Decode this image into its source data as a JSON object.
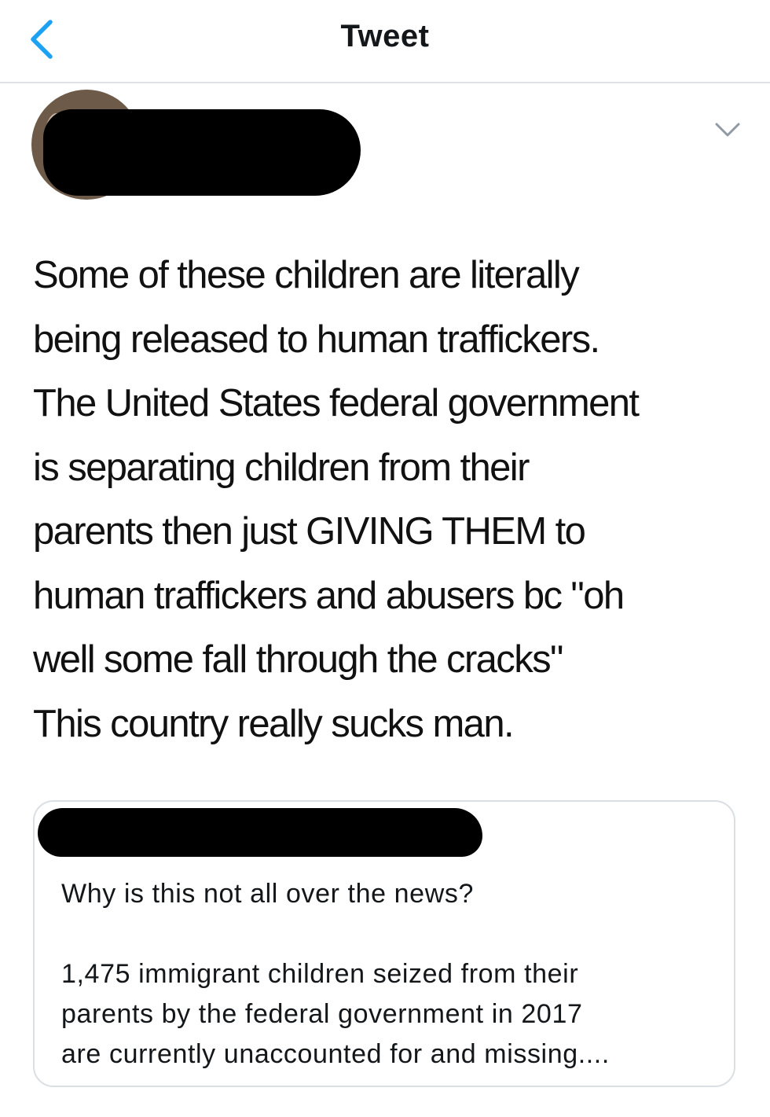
{
  "nav": {
    "title": "Tweet",
    "back_icon": "chevron-left-icon",
    "accent_color": "#1da1f2"
  },
  "tweet": {
    "author": {
      "avatar": "avatar",
      "name_redacted": true
    },
    "menu_icon": "chevron-down-icon",
    "text": "Some of these children are literally\nbeing released to human traffickers.\nThe United States federal government\nis separating children from their\nparents then just GIVING THEM to\nhuman traffickers and abusers bc \"oh\nwell some fall through the cracks\"\nThis country really sucks man."
  },
  "quoted_tweet": {
    "author_redacted": true,
    "text": "Why is this not all over the news?\n\n1,475 immigrant children seized from their\nparents by the federal government in 2017\nare currently unaccounted for and missing...."
  }
}
